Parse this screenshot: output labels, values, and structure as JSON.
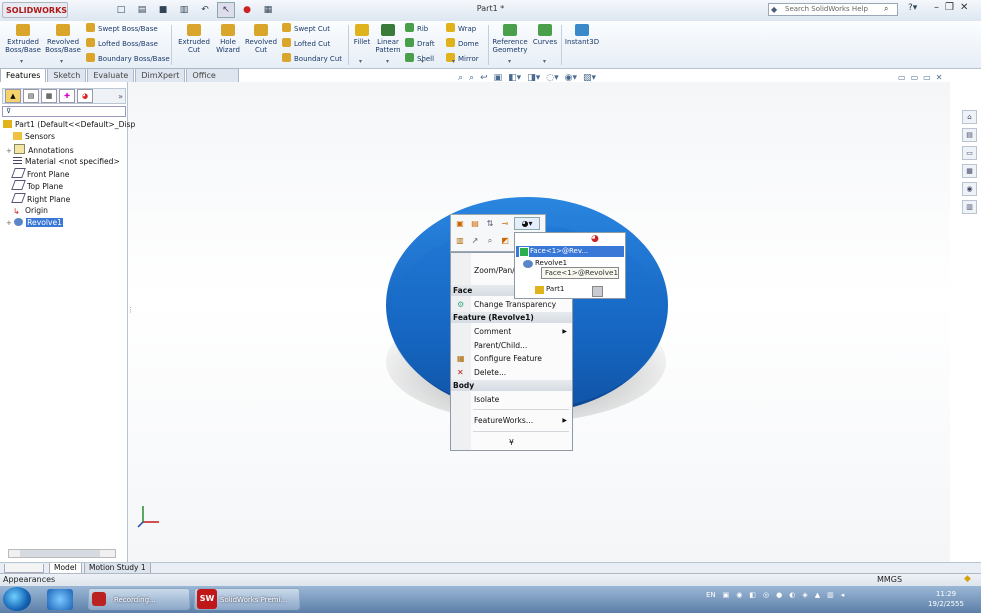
{
  "titlebar": {
    "logo": "SOLIDWORKS",
    "document_title": "Part1 *",
    "search_placeholder": "Search SolidWorks Help"
  },
  "ribbon": {
    "big_buttons": [
      {
        "label": "Extruded Boss/Base",
        "color": "#d9a62b"
      },
      {
        "label": "Revolved Boss/Base",
        "color": "#d9a62b"
      },
      {
        "label": "Extruded Cut",
        "color": "#d9a62b"
      },
      {
        "label": "Hole Wizard",
        "color": "#d9a62b"
      },
      {
        "label": "Revolved Cut",
        "color": "#d9a62b"
      },
      {
        "label": "Fillet",
        "color": "#e0b21c"
      },
      {
        "label": "Linear Pattern",
        "color": "#3a7b3a"
      },
      {
        "label": "Reference Geometry",
        "color": "#4aa04a"
      },
      {
        "label": "Curves",
        "color": "#4aa04a"
      },
      {
        "label": "Instant3D",
        "color": "#3a8acb"
      }
    ],
    "small_buttons": [
      {
        "label": "Swept Boss/Base"
      },
      {
        "label": "Lofted Boss/Base"
      },
      {
        "label": "Boundary Boss/Base"
      },
      {
        "label": "Swept Cut"
      },
      {
        "label": "Lofted Cut"
      },
      {
        "label": "Boundary Cut"
      },
      {
        "label": "Rib"
      },
      {
        "label": "Draft"
      },
      {
        "label": "Shell"
      },
      {
        "label": "Wrap"
      },
      {
        "label": "Dome"
      },
      {
        "label": "Mirror"
      }
    ]
  },
  "command_tabs": [
    "Features",
    "Sketch",
    "Evaluate",
    "DimXpert",
    "Office Products"
  ],
  "feature_tree": {
    "root": "Part1  (Default<<Default>_Disp",
    "items": [
      "Sensors",
      "Annotations",
      "Material <not specified>",
      "Front Plane",
      "Top Plane",
      "Right Plane",
      "Origin",
      "Revolve1"
    ],
    "selected": "Revolve1"
  },
  "bottom_tabs": [
    "Model",
    "Motion Study 1"
  ],
  "status": {
    "left_text": "Appearances",
    "units": "MMGS"
  },
  "context_menu": {
    "top_item": "Zoom/Pan/",
    "sections": [
      {
        "header": "Face",
        "items": [
          {
            "label": "Change Transparency",
            "submenu": false
          }
        ]
      },
      {
        "header": "Feature (Revolve1)",
        "items": [
          {
            "label": "Comment",
            "submenu": true
          },
          {
            "label": "Parent/Child...",
            "submenu": false
          },
          {
            "label": "Configure Feature",
            "submenu": false
          },
          {
            "label": "Delete...",
            "submenu": false
          }
        ]
      },
      {
        "header": "Body",
        "items": [
          {
            "label": "Isolate",
            "submenu": false
          },
          {
            "label": "FeatureWorks...",
            "submenu": true
          }
        ]
      }
    ],
    "more_glyph": "¥"
  },
  "selection_popup": {
    "rows": [
      "Face<1>@Rev...",
      "Revolve1",
      "Part1"
    ],
    "tooltip": "Face<1>@Revolve1"
  },
  "taskbar": {
    "apps": [
      "Recording...",
      "SolidWorks Premi..."
    ],
    "language": "EN",
    "time": "11:29",
    "date": "19/2/2555"
  },
  "colors": {
    "model_blue": "#1564bf",
    "selection_blue": "#3a78d8",
    "accent_red": "#c01818"
  }
}
